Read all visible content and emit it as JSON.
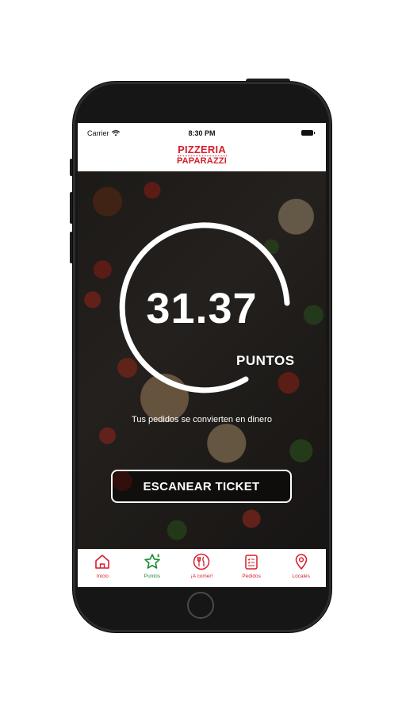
{
  "status_bar": {
    "carrier": "Carrier",
    "time": "8:30 PM"
  },
  "brand": {
    "line1": "PIZZERIA",
    "line2": "PAPARAZZI",
    "color": "#d61f2c"
  },
  "points": {
    "value": "31.37",
    "label": "PUNTOS"
  },
  "tagline": "Tus pedidos se convierten en dinero",
  "actions": {
    "scan_label": "ESCANEAR TICKET"
  },
  "tabbar": {
    "active_color": "#1a8a2e",
    "items": [
      {
        "label": "Inicio",
        "icon": "home-icon"
      },
      {
        "label": "Puntos",
        "icon": "star-icon",
        "active": true
      },
      {
        "label": "¡A comer!",
        "icon": "utensils-icon"
      },
      {
        "label": "Pedidos",
        "icon": "order-list-icon"
      },
      {
        "label": "Locales",
        "icon": "location-pin-icon"
      }
    ]
  }
}
